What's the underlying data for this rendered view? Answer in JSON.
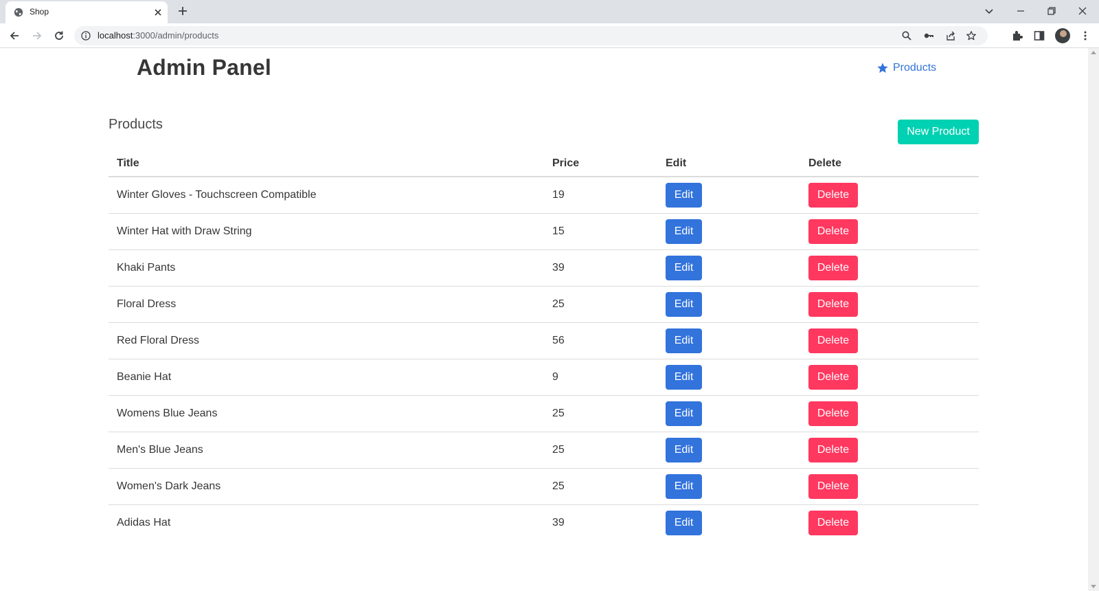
{
  "browser": {
    "tab_title": "Shop",
    "url_host": "localhost",
    "url_rest": ":3000/admin/products"
  },
  "header": {
    "brand": "Admin Panel",
    "nav_link": "Products",
    "nav_link_color": "#3273dc"
  },
  "main": {
    "section_title": "Products",
    "new_button": "New Product",
    "columns": [
      "Title",
      "Price",
      "Edit",
      "Delete"
    ],
    "rows": [
      {
        "title": "Winter Gloves - Touchscreen Compatible",
        "price": "19"
      },
      {
        "title": "Winter Hat with Draw String",
        "price": "15"
      },
      {
        "title": "Khaki Pants",
        "price": "39"
      },
      {
        "title": "Floral Dress",
        "price": "25"
      },
      {
        "title": "Red Floral Dress",
        "price": "56"
      },
      {
        "title": "Beanie Hat",
        "price": "9"
      },
      {
        "title": "Womens Blue Jeans",
        "price": "25"
      },
      {
        "title": "Men's Blue Jeans",
        "price": "25"
      },
      {
        "title": "Women's Dark Jeans",
        "price": "25"
      },
      {
        "title": "Adidas Hat",
        "price": "39"
      }
    ],
    "edit_label": "Edit",
    "delete_label": "Delete"
  },
  "colors": {
    "primary": "#3273dc",
    "success": "#00d1b2",
    "danger": "#ff3860"
  }
}
